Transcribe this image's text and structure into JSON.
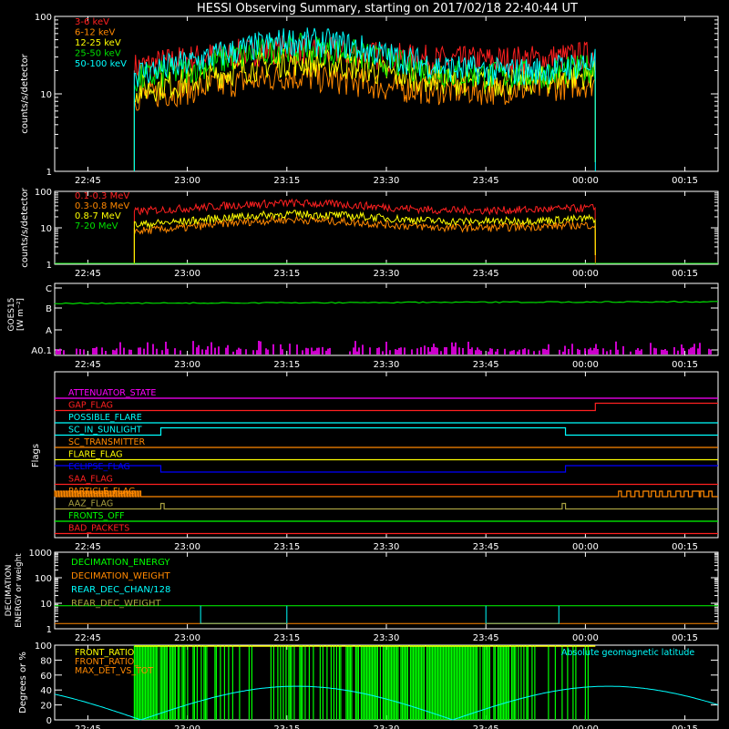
{
  "title": "HESSI Observing Summary, starting on 2017/02/18 22:40:44 UT",
  "time_ticks": [
    "22:45",
    "23:00",
    "23:15",
    "23:30",
    "23:45",
    "00:00",
    "00:15"
  ],
  "colors": {
    "red": "#ff2020",
    "orange": "#ff8800",
    "yellow": "#ffff00",
    "green": "#00e000",
    "cyan": "#00ffff",
    "magenta": "#ff00ff",
    "blue": "#0000ff",
    "olive": "#a8a040",
    "white": "#ffffff",
    "lime": "#00ff00"
  },
  "chart_data": [
    {
      "type": "line",
      "panel": "rates_low",
      "ylabel": "counts/s/detector",
      "yscale": "log",
      "ylim": [
        1,
        100
      ],
      "ytick_labels": [
        "1",
        "10",
        "100"
      ],
      "data_start": "22:52",
      "data_end": "00:01",
      "series": [
        {
          "name": "3-6 keV",
          "color": "red",
          "level": [
            22,
            28,
            33,
            38,
            34,
            30,
            27,
            27,
            28,
            32
          ]
        },
        {
          "name": "6-12 keV",
          "color": "orange",
          "level": [
            9,
            11,
            14,
            17,
            15,
            12,
            11,
            11,
            12,
            14
          ]
        },
        {
          "name": "12-25 keV",
          "color": "yellow",
          "level": [
            11,
            14,
            20,
            26,
            24,
            18,
            15,
            14,
            15,
            18
          ]
        },
        {
          "name": "25-50 keV",
          "color": "green",
          "level": [
            15,
            20,
            30,
            40,
            36,
            25,
            19,
            17,
            18,
            22
          ]
        },
        {
          "name": "50-100 keV",
          "color": "cyan",
          "level": [
            18,
            24,
            36,
            48,
            44,
            30,
            22,
            19,
            20,
            25
          ]
        }
      ]
    },
    {
      "type": "line",
      "panel": "rates_high",
      "ylabel": "counts/s/detector",
      "yscale": "log",
      "ylim": [
        1,
        100
      ],
      "ytick_labels": [
        "1",
        "10",
        "100"
      ],
      "data_start": "22:52",
      "data_end": "00:01",
      "series": [
        {
          "name": "0.1-0.3 MeV",
          "color": "red",
          "level": [
            28,
            34,
            42,
            48,
            44,
            36,
            30,
            30,
            32,
            35
          ]
        },
        {
          "name": "0.3-0.8 MeV",
          "color": "orange",
          "level": [
            8,
            10,
            14,
            17,
            15,
            12,
            10,
            10,
            11,
            12
          ]
        },
        {
          "name": "0.8-7 MeV",
          "color": "yellow",
          "level": [
            12,
            15,
            20,
            24,
            22,
            18,
            15,
            15,
            16,
            18
          ]
        },
        {
          "name": "7-20 MeV",
          "color": "green",
          "level": [
            1,
            1,
            1,
            1,
            1,
            1,
            1,
            1,
            1,
            1
          ]
        }
      ]
    },
    {
      "type": "line",
      "panel": "goes",
      "ylabel": "GOES15",
      "ylabel2": "[W m⁻²]",
      "ytick_labels": [
        "A0.1",
        "A",
        "B",
        "C"
      ],
      "series": [
        {
          "name": "GOES",
          "color": "green",
          "level": 0.65
        }
      ]
    },
    {
      "type": "line",
      "panel": "flags",
      "ylabel": "Flags",
      "series": [
        {
          "name": "ATTENUATOR_STATE",
          "color": "magenta"
        },
        {
          "name": "GAP_FLAG",
          "color": "red"
        },
        {
          "name": "POSSIBLE_FLARE",
          "color": "cyan"
        },
        {
          "name": "SC_IN_SUNLIGHT",
          "color": "cyan"
        },
        {
          "name": "SC_TRANSMITTER",
          "color": "orange"
        },
        {
          "name": "FLARE_FLAG",
          "color": "yellow"
        },
        {
          "name": "ECLIPSE_FLAG",
          "color": "blue"
        },
        {
          "name": "SAA_FLAG",
          "color": "red"
        },
        {
          "name": "PARTICLE_FLAG",
          "color": "orange"
        },
        {
          "name": "AAZ_FLAG",
          "color": "olive"
        },
        {
          "name": "FRONTS_OFF",
          "color": "lime"
        },
        {
          "name": "BAD_PACKETS",
          "color": "red"
        }
      ]
    },
    {
      "type": "line",
      "panel": "decimation",
      "ylabel": "DECIMATION",
      "ylabel2": "ENERGY or weight",
      "yscale": "log",
      "ylim": [
        1,
        1000
      ],
      "ytick_labels": [
        "1",
        "10",
        "100",
        "1000"
      ],
      "series": [
        {
          "name": "DECIMATION_ENERGY",
          "color": "lime"
        },
        {
          "name": "DECIMATION_WEIGHT",
          "color": "orange"
        },
        {
          "name": "REAR_DEC_CHAN/128",
          "color": "cyan"
        },
        {
          "name": "REAR_DEC_WEIGHT",
          "color": "olive"
        }
      ]
    },
    {
      "type": "line",
      "panel": "ratios",
      "ylabel": "Degrees or %",
      "ylim": [
        0,
        100
      ],
      "ytick_labels": [
        "0",
        "20",
        "40",
        "60",
        "80",
        "100"
      ],
      "series": [
        {
          "name": "FRONT_RATIO",
          "color": "yellow"
        },
        {
          "name": "FRONT_RATIO_",
          "color": "orange"
        },
        {
          "name": "MAX_DET_VS_TOT",
          "color": "orange"
        },
        {
          "name": "Absolute geomagnetic latitude",
          "color": "cyan"
        }
      ]
    }
  ]
}
